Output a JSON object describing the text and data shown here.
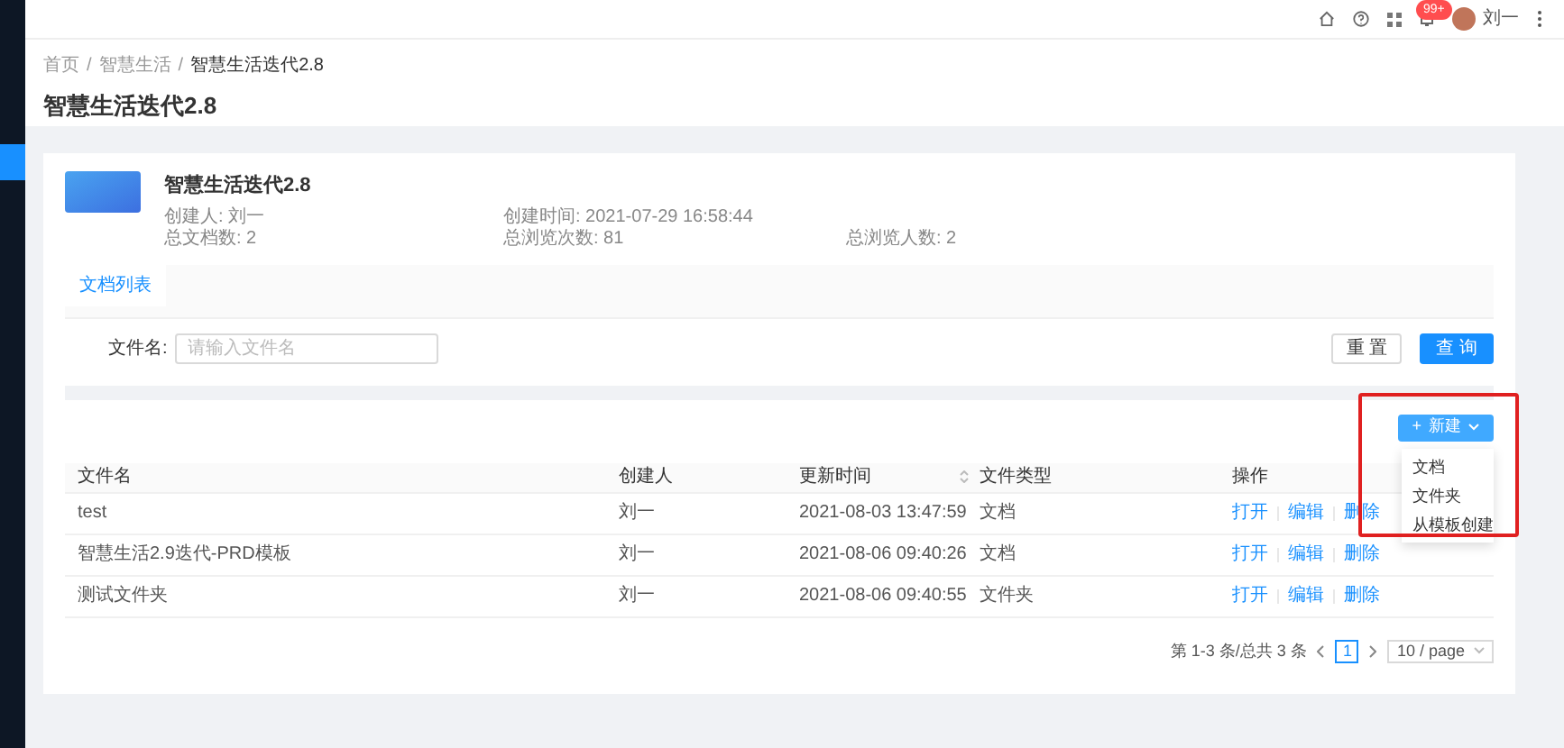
{
  "header": {
    "notification_badge": "99+",
    "user_name": "刘一"
  },
  "breadcrumb": {
    "separator": "/",
    "items": [
      "首页",
      "智慧生活",
      "智慧生活迭代2.8"
    ]
  },
  "page_title": "智慧生活迭代2.8",
  "project": {
    "title": "智慧生活迭代2.8",
    "meta_rows": [
      [
        "创建人: 刘一",
        "创建时间: 2021-07-29 16:58:44"
      ],
      [
        "总文档数: 2",
        "总浏览次数: 81",
        "总浏览人数: 2"
      ]
    ]
  },
  "tabs": [
    {
      "label": "文档列表",
      "selected": true
    }
  ],
  "filter": {
    "label": "文件名:",
    "placeholder": "请输入文件名",
    "buttons": [
      {
        "label": "重 置",
        "kind": "default"
      },
      {
        "label": "查 询",
        "kind": "primary"
      }
    ]
  },
  "new_button": {
    "icon": "+",
    "label": "新建"
  },
  "new_menu": [
    "文档",
    "文件夹",
    "从模板创建"
  ],
  "table": {
    "columns": [
      {
        "label": "文件名",
        "sortable": false
      },
      {
        "label": "创建人",
        "sortable": false
      },
      {
        "label": "更新时间",
        "sortable": true
      },
      {
        "label": "文件类型",
        "sortable": false
      },
      {
        "label": "操作",
        "sortable": false
      }
    ],
    "rows": [
      {
        "cells": [
          "test",
          "刘一",
          "2021-08-03 13:47:59",
          "文档"
        ],
        "actions": [
          "打开",
          "编辑",
          "删除"
        ]
      },
      {
        "cells": [
          "智慧生活2.9迭代-PRD模板",
          "刘一",
          "2021-08-06 09:40:26",
          "文档"
        ],
        "actions": [
          "打开",
          "编辑",
          "删除"
        ]
      },
      {
        "cells": [
          "测试文件夹",
          "刘一",
          "2021-08-06 09:40:55",
          "文件夹"
        ],
        "actions": [
          "打开",
          "编辑",
          "删除"
        ]
      }
    ]
  },
  "pagination": {
    "summary": "第 1-3 条/总共 3 条",
    "pages": [
      {
        "label": "1",
        "selected": true
      }
    ],
    "page_size": "10 / page"
  }
}
